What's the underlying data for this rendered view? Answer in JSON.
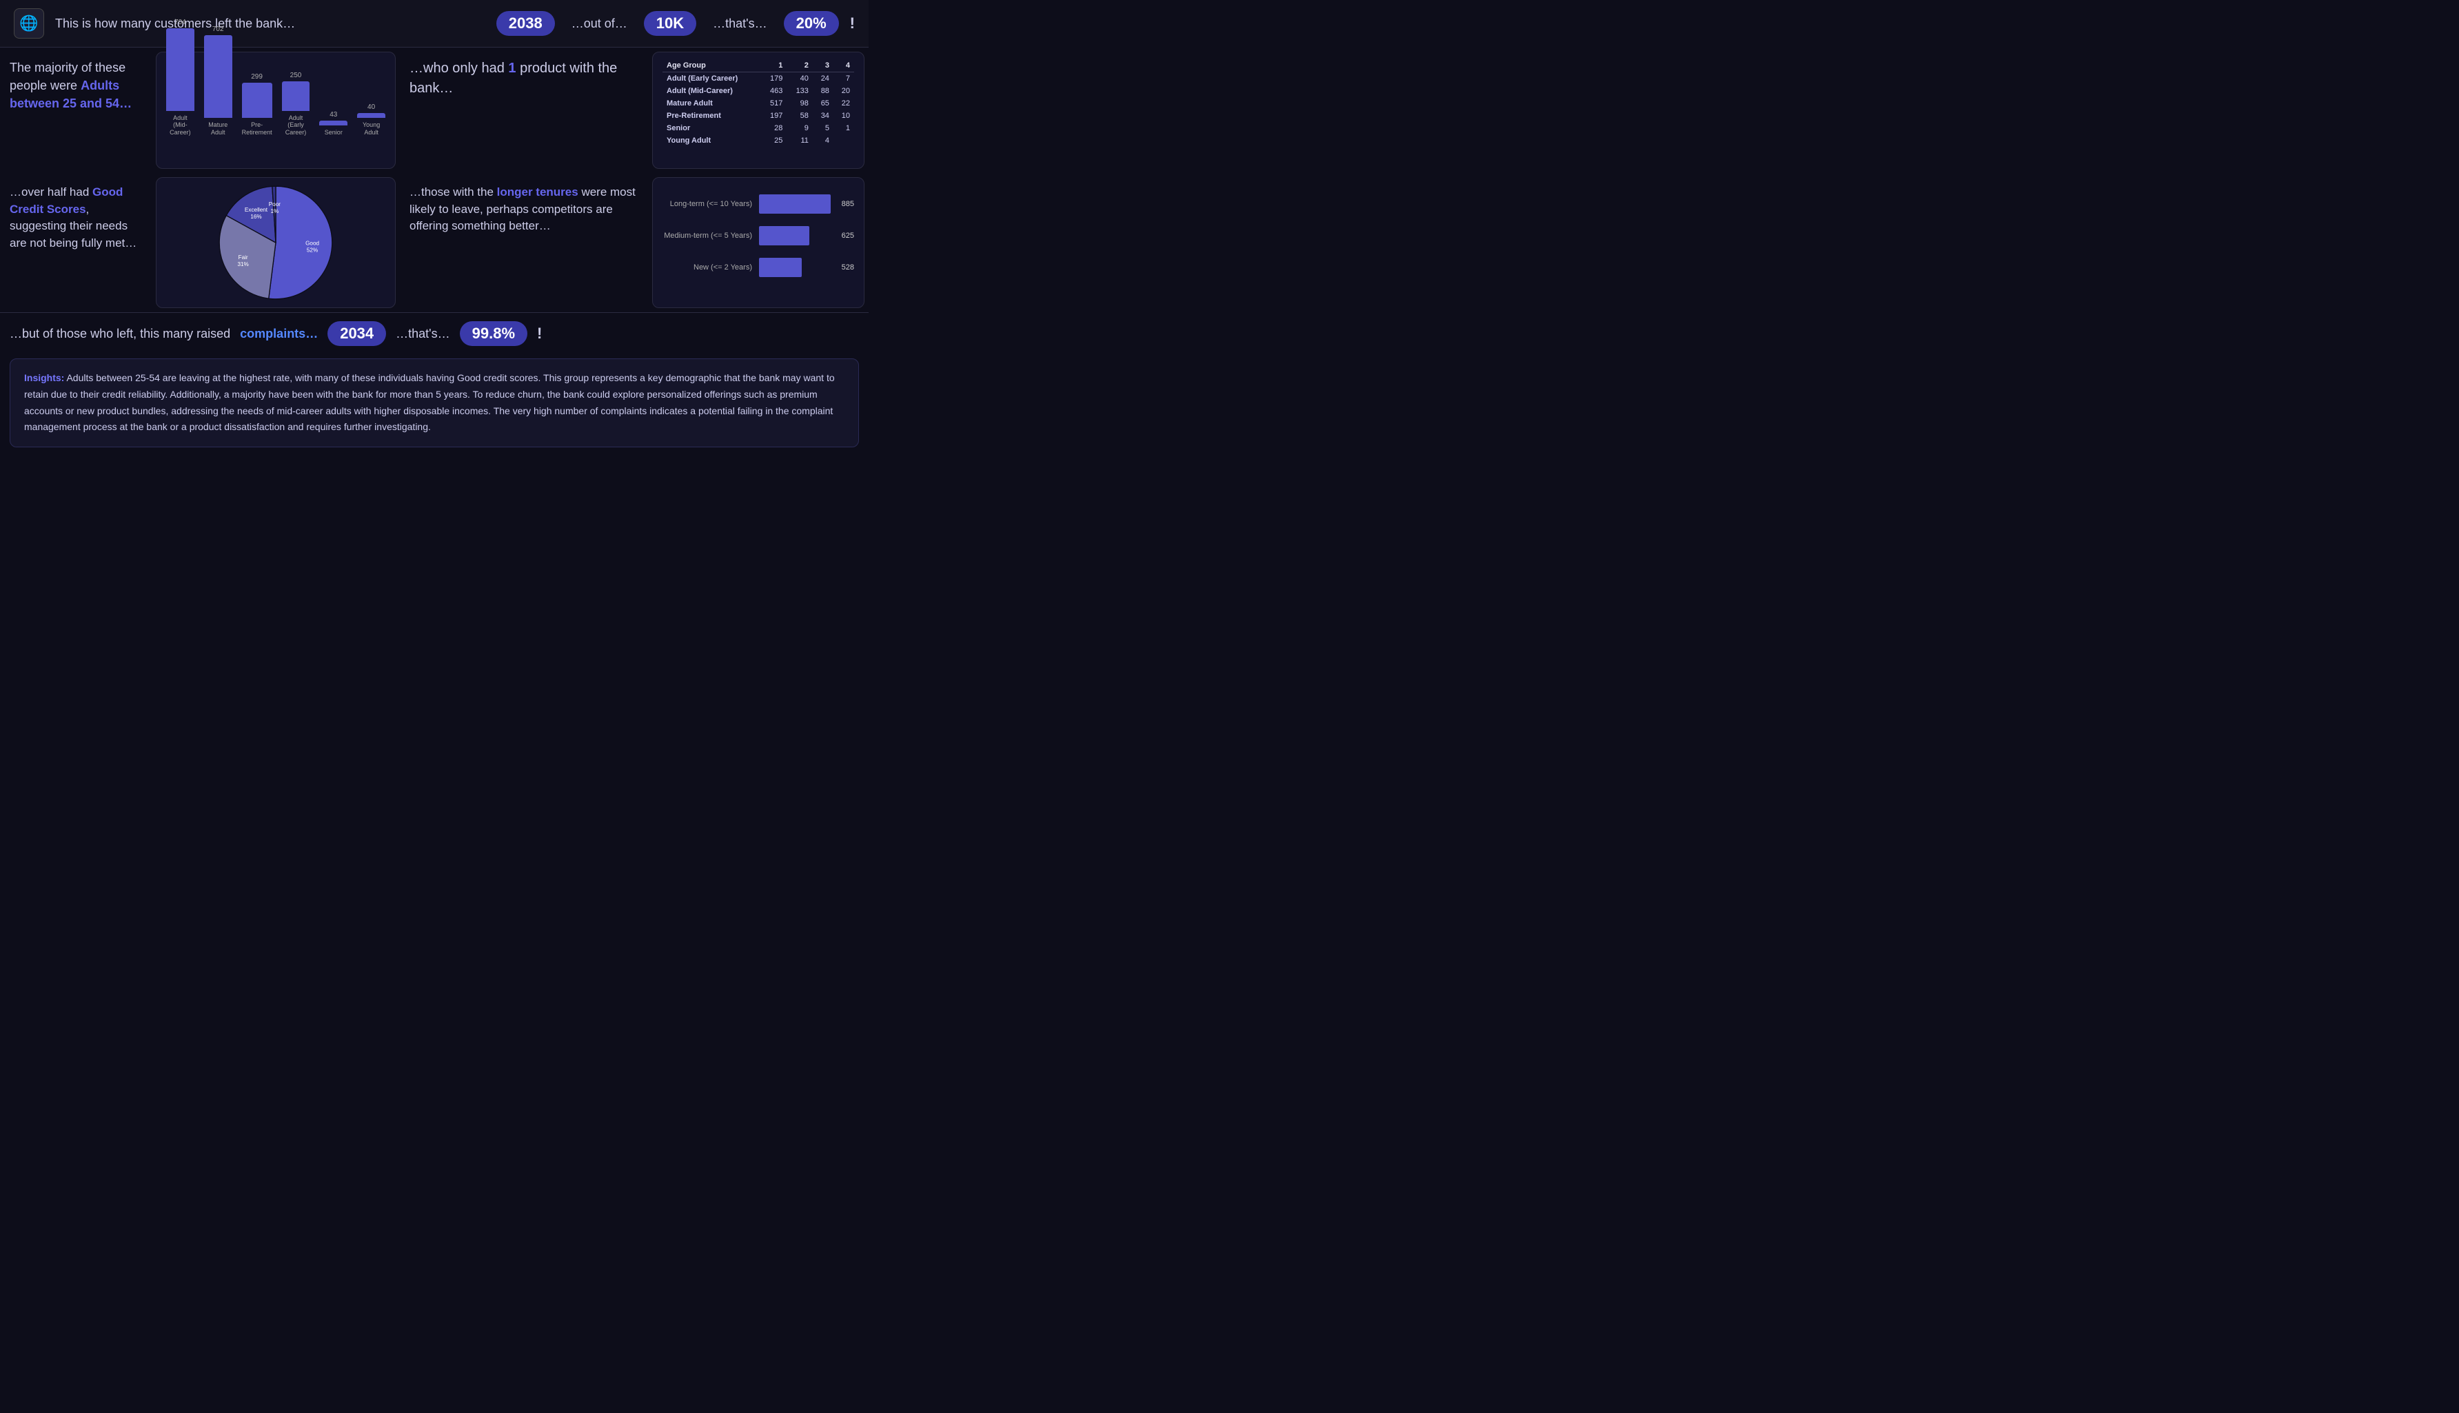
{
  "header": {
    "logo": "🌐",
    "text": "This is how many customers left the bank…",
    "badge1": "2038",
    "label1": "…out of…",
    "badge2": "10K",
    "label2": "…that's…",
    "badge3": "20%",
    "exclaim": "!"
  },
  "top_left_text": {
    "line1": "The majority of",
    "line2": "these people were",
    "accent": "Adults between 25 and 54…"
  },
  "bar_chart": {
    "bars": [
      {
        "label": "Adult\n(Mid-Career)",
        "value": 704,
        "height": 130
      },
      {
        "label": "Mature Adult",
        "value": 702,
        "height": 129
      },
      {
        "label": "Pre-Retirement",
        "value": 299,
        "height": 55
      },
      {
        "label": "Adult (Early\nCareer)",
        "value": 250,
        "height": 46
      },
      {
        "label": "Senior",
        "value": 43,
        "height": 8
      },
      {
        "label": "Young Adult",
        "value": 40,
        "height": 7
      }
    ]
  },
  "products_text": {
    "line1": "…who only had",
    "accent": "1",
    "line2": "product with the bank…"
  },
  "age_table": {
    "headers": [
      "Age Group",
      "1",
      "2",
      "3",
      "4"
    ],
    "rows": [
      [
        "Adult (Early Career)",
        "179",
        "40",
        "24",
        "7"
      ],
      [
        "Adult (Mid-Career)",
        "463",
        "133",
        "88",
        "20"
      ],
      [
        "Mature Adult",
        "517",
        "98",
        "65",
        "22"
      ],
      [
        "Pre-Retirement",
        "197",
        "58",
        "34",
        "10"
      ],
      [
        "Senior",
        "28",
        "9",
        "5",
        "1"
      ],
      [
        "Young Adult",
        "25",
        "11",
        "4",
        ""
      ]
    ]
  },
  "credit_text": {
    "line1": "…over half had",
    "accent": "Good Credit Scores",
    "line2": ", suggesting their needs are not being fully met…"
  },
  "pie_chart": {
    "segments": [
      {
        "label": "Good",
        "value": 52,
        "color": "#5555cc",
        "start": 0,
        "end": 187.2
      },
      {
        "label": "Fair",
        "value": 31,
        "color": "#7777aa",
        "start": 187.2,
        "end": 298.8
      },
      {
        "label": "Excellent",
        "value": 16,
        "color": "#4444aa",
        "start": 298.8,
        "end": 356.4
      },
      {
        "label": "Poor",
        "value": 1,
        "color": "#333388",
        "start": 356.4,
        "end": 360
      }
    ]
  },
  "tenure_text": {
    "line1": "…those with the",
    "accent": "longer tenures",
    "line2": "were most likely to leave, perhaps competitors are offering something better…"
  },
  "hbar_chart": {
    "bars": [
      {
        "label": "Long-term (<= 10 Years)",
        "value": 885,
        "pct": 100
      },
      {
        "label": "Medium-term (<= 5 Years)",
        "value": 625,
        "pct": 70
      },
      {
        "label": "New (<= 2 Years)",
        "value": 528,
        "pct": 60
      }
    ]
  },
  "bottom": {
    "text": "…but of those who left, this many raised",
    "accent": "complaints…",
    "badge1": "2034",
    "label1": "…that's…",
    "badge2": "99.8%",
    "exclaim": "!"
  },
  "insights": {
    "label": "Insights:",
    "text": " Adults between 25-54 are leaving at the highest rate, with many of these individuals having Good credit scores. This group represents a key demographic that the bank may want to retain due to their credit reliability. Additionally, a majority have been with the bank for more than 5 years. To reduce churn, the bank could explore personalized offerings such as premium accounts or new product bundles, addressing the needs of mid-career adults with higher disposable incomes. The very high number of complaints indicates a potential failing in the complaint management process at the bank or a product dissatisfaction and requires further investigating."
  }
}
